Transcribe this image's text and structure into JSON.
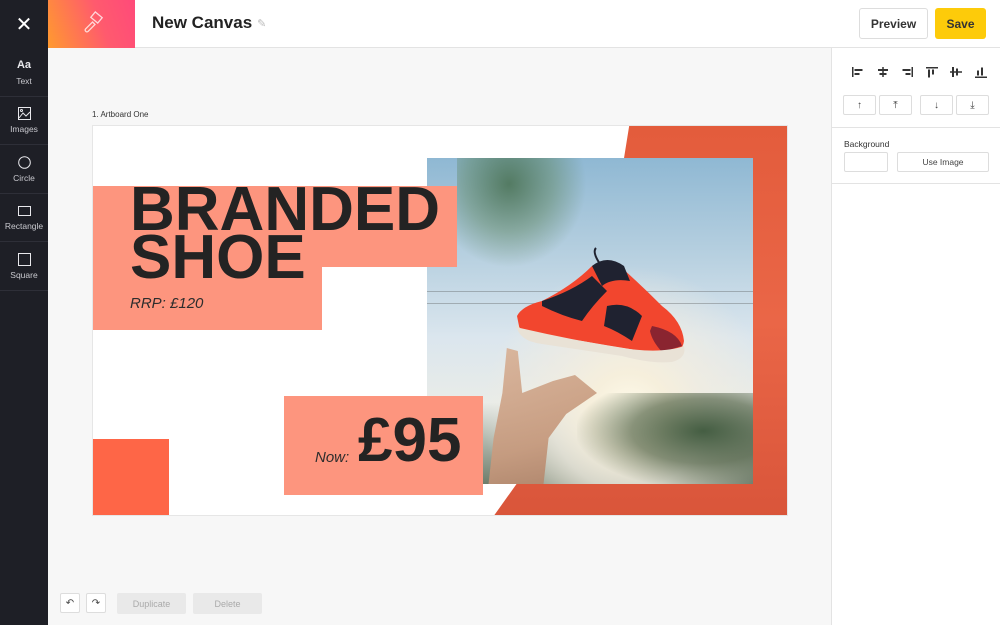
{
  "header": {
    "title": "New Canvas",
    "close_icon": "close-icon",
    "brand_icon": "paintbrush-icon",
    "edit_icon": "pencil-icon",
    "preview_label": "Preview",
    "save_label": "Save",
    "save_color": "#fdcb0a"
  },
  "sidebar": {
    "items": [
      {
        "label": "Text",
        "icon": "Aa"
      },
      {
        "label": "Images",
        "icon": "image-icon"
      },
      {
        "label": "Circle",
        "icon": "circle-icon"
      },
      {
        "label": "Rectangle",
        "icon": "rectangle-icon"
      },
      {
        "label": "Square",
        "icon": "square-icon"
      }
    ]
  },
  "canvas": {
    "artboard_label": "1. Artboard One",
    "headline_line1": "BRANDED",
    "headline_line2": "SHOE",
    "rrp": "RRP: £120",
    "now_label": "Now:",
    "price": "£95",
    "colors": {
      "pink_block": "#fd957e",
      "red_square": "#fe6647",
      "orange_shape": "#e35c3c"
    }
  },
  "bottom_actions": {
    "undo_icon": "↶",
    "redo_icon": "↷",
    "duplicate_label": "Duplicate",
    "delete_label": "Delete"
  },
  "right_panel": {
    "align_icons": [
      "align-left-icon",
      "align-center-horizontal-icon",
      "align-right-icon",
      "align-top-icon",
      "align-middle-vertical-icon",
      "align-bottom-icon"
    ],
    "order_buttons": [
      {
        "name": "bring-forward",
        "glyph": "↑"
      },
      {
        "name": "bring-to-front",
        "glyph": "⤒"
      },
      {
        "name": "send-backward",
        "glyph": "↓"
      },
      {
        "name": "send-to-back",
        "glyph": "⤓"
      }
    ],
    "background_label": "Background",
    "use_image_label": "Use Image"
  }
}
